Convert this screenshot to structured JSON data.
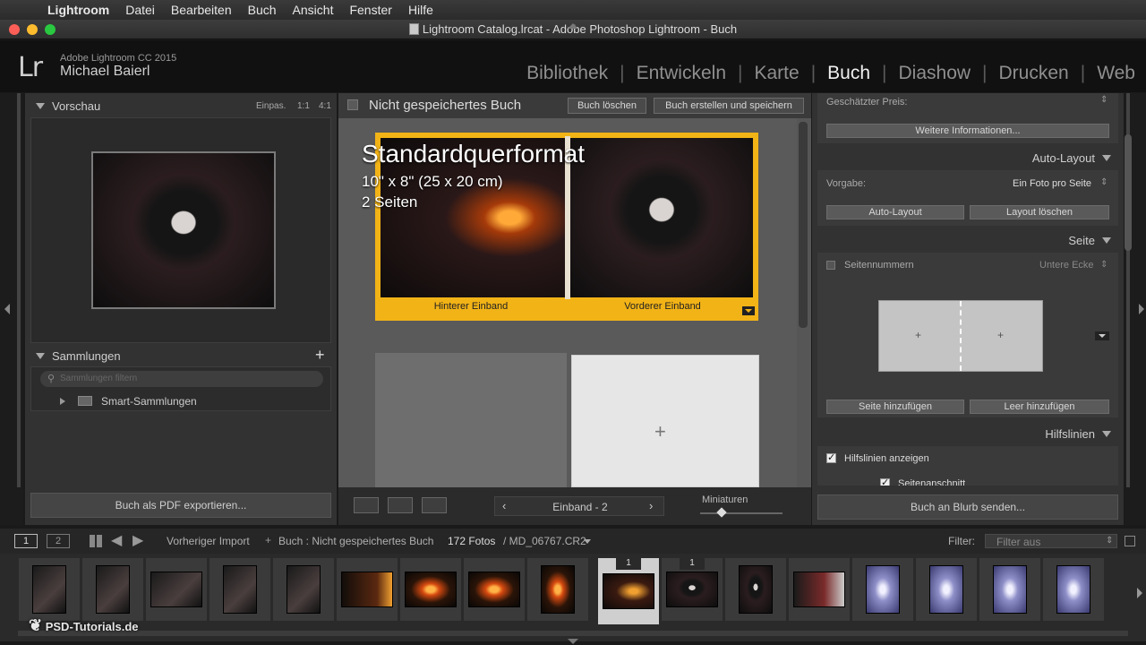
{
  "menubar": {
    "items": [
      "Lightroom",
      "Datei",
      "Bearbeiten",
      "Buch",
      "Ansicht",
      "Fenster",
      "Hilfe"
    ]
  },
  "window": {
    "title": "Lightroom Catalog.lrcat - Adobe Photoshop Lightroom - Buch"
  },
  "identity": {
    "logo": "Lr",
    "app": "Adobe Lightroom CC 2015",
    "user": "Michael Baierl"
  },
  "modules": [
    "Bibliothek",
    "Entwickeln",
    "Karte",
    "Buch",
    "Diashow",
    "Drucken",
    "Web"
  ],
  "active_module": "Buch",
  "left_panel": {
    "preview": {
      "title": "Vorschau",
      "zoom_options": [
        "Einpas.",
        "1:1",
        "4:1"
      ]
    },
    "collections": {
      "title": "Sammlungen",
      "add_icon": "plus-icon",
      "search_placeholder": "Sammlungen filtern",
      "items": [
        {
          "label": "Smart-Sammlungen",
          "icon": "smart-collection-icon"
        }
      ]
    },
    "export_button": "Buch als PDF exportieren..."
  },
  "center": {
    "book_title": "Nicht gespeichertes Buch",
    "delete_button": "Buch löschen",
    "create_button": "Buch erstellen und speichern",
    "cover": {
      "format_title": "Standardquerformat",
      "format_size": "10\" x 8\" (25 x 20 cm)",
      "pages": "2 Seiten",
      "back_label": "Hinterer Einband",
      "front_label": "Vorderer Einband"
    },
    "toolbar": {
      "page_nav": "Einband - 2",
      "thumb_label": "Miniaturen"
    }
  },
  "right_panel": {
    "price_label": "Geschätzter Preis:",
    "more_info_button": "Weitere Informationen...",
    "auto_layout": {
      "title": "Auto-Layout",
      "preset_label": "Vorgabe:",
      "preset_value": "Ein Foto pro Seite",
      "auto_button": "Auto-Layout",
      "clear_button": "Layout löschen"
    },
    "page": {
      "title": "Seite",
      "page_numbers_label": "Seitennummern",
      "page_numbers_checked": false,
      "page_numbers_position": "Untere Ecke",
      "add_page_button": "Seite hinzufügen",
      "add_blank_button": "Leer hinzufügen"
    },
    "guides": {
      "title": "Hilfslinien",
      "show_guides_label": "Hilfslinien anzeigen",
      "show_guides_checked": true,
      "bleed_label": "Seitenanschnitt",
      "bleed_checked": true
    },
    "send_button": "Buch an Blurb senden..."
  },
  "filmstrip_bar": {
    "screen1": "1",
    "screen2": "2",
    "source": "Vorheriger Import",
    "breadcrumb": "Buch : Nicht gespeichertes Buch",
    "count": "172 Fotos",
    "file": "/ MD_06767.CR2",
    "filter_label": "Filter:",
    "filter_value": "Filter aus"
  },
  "filmstrip": {
    "badge_1": "1",
    "badge_2": "1",
    "watermark": "PSD-Tutorials.de"
  },
  "colors": {
    "accent_yellow": "#f2b316",
    "panel_bg": "#323232",
    "canvas_bg": "#565656"
  }
}
